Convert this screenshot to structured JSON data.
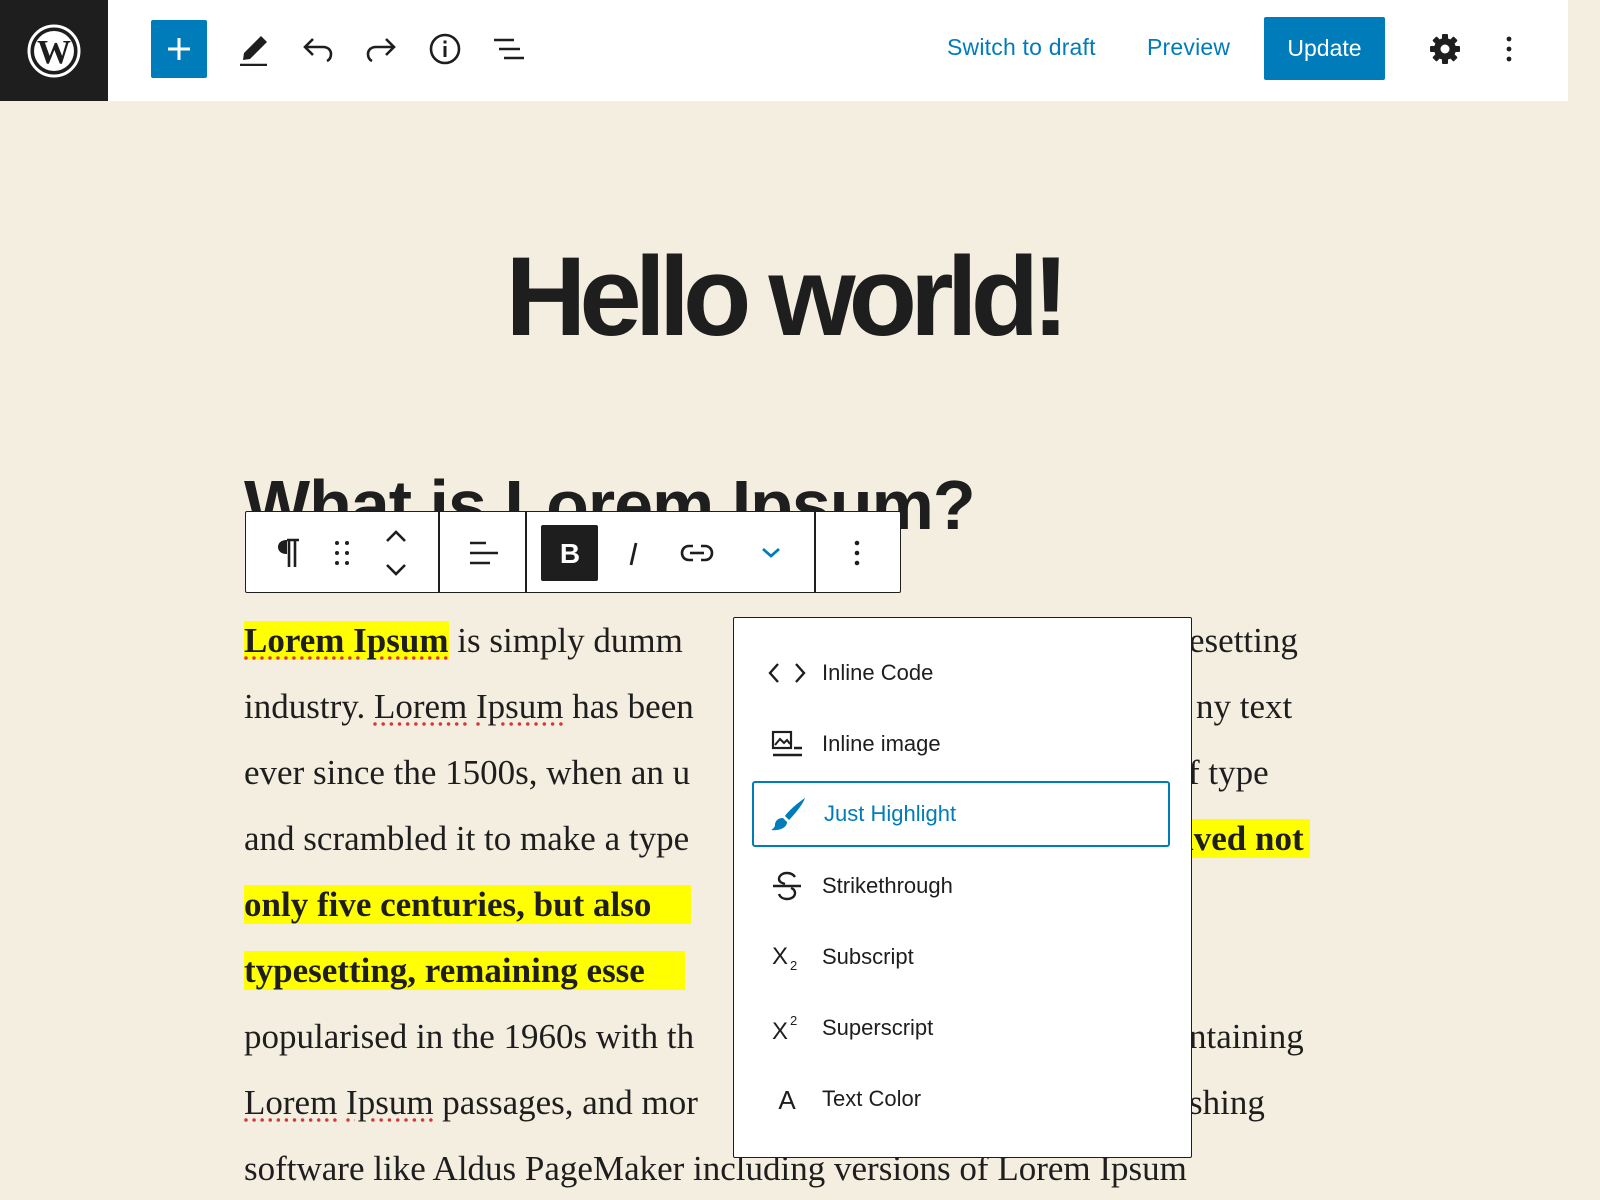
{
  "toolbar": {
    "switch_to_draft": "Switch to draft",
    "preview": "Preview",
    "update": "Update"
  },
  "post": {
    "title": "Hello world!",
    "heading": "What is Lorem Ipsum?",
    "lines": [
      {
        "a": "Lorem Ipsum",
        "b": " is simply dumm",
        "c": "esetting"
      },
      {
        "a": "industry. ",
        "b": "Lorem",
        "c": " ",
        "d": "Ipsum",
        "e": " has been",
        "f": "ny text"
      },
      {
        "a": "ever since the 1500s, when an u",
        "b": "f type"
      },
      {
        "a": "and scrambled it to make a type",
        "b": "ived not"
      },
      {
        "a": "only five centuries, but also"
      },
      {
        "a": "typesetting, remaining esse"
      },
      {
        "a": "popularised in the 1960s with th",
        "b": "ntaining"
      },
      {
        "a": "Lorem",
        "b": " ",
        "c": "Ipsum",
        "d": " passages, and mor",
        "e": "shing"
      },
      {
        "a": "software like Aldus PageMaker including versions of Lorem Ipsum"
      }
    ]
  },
  "format_menu": {
    "items": [
      {
        "label": "Inline Code",
        "icon": "code-icon"
      },
      {
        "label": "Inline image",
        "icon": "image-icon"
      },
      {
        "label": "Just Highlight",
        "icon": "brush-icon",
        "active": true
      },
      {
        "label": "Strikethrough",
        "icon": "strikethrough-icon"
      },
      {
        "label": "Subscript",
        "icon": "subscript-icon"
      },
      {
        "label": "Superscript",
        "icon": "superscript-icon"
      },
      {
        "label": "Text Color",
        "icon": "text-color-icon"
      }
    ]
  },
  "colors": {
    "accent": "#007cba",
    "highlight": "#ffff00",
    "canvas_bg": "#f4eee0",
    "dark": "#1e1e1e"
  }
}
